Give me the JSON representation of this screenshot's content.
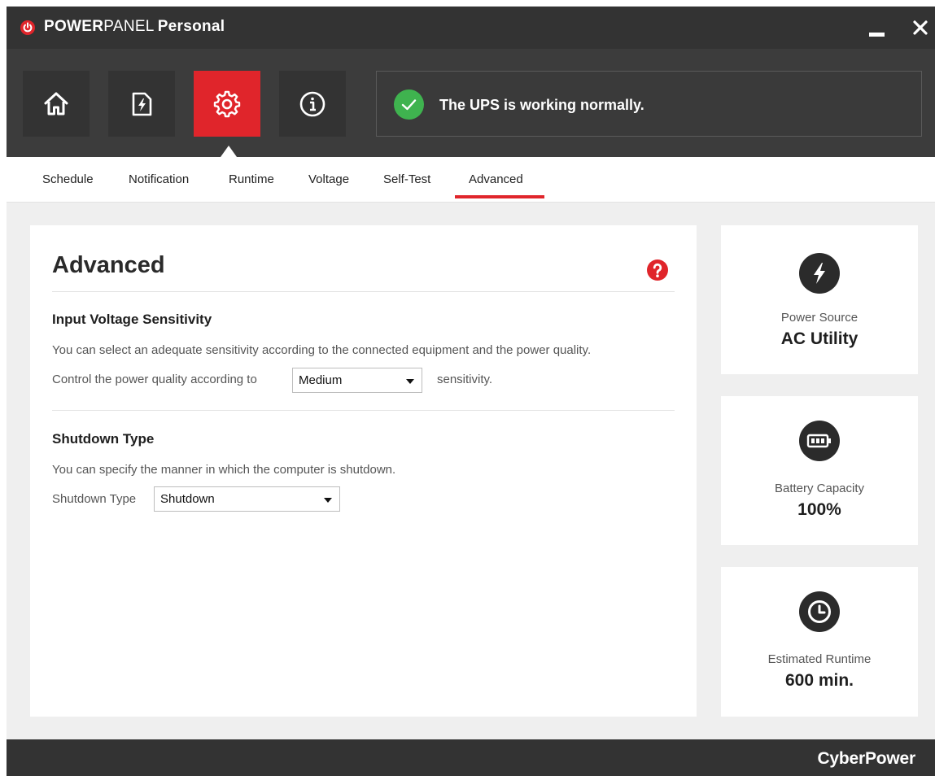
{
  "app": {
    "title_bold": "POWER",
    "title_light": "PANEL",
    "title_edition": "Personal"
  },
  "toolbar": {
    "buttons": [
      {
        "icon": "home-icon",
        "active": false
      },
      {
        "icon": "power-event-icon",
        "active": false
      },
      {
        "icon": "settings-gear-icon",
        "active": true
      },
      {
        "icon": "info-icon",
        "active": false
      }
    ],
    "status_text": "The UPS is working normally."
  },
  "tabs": [
    "Schedule",
    "Notification",
    "Runtime",
    "Voltage",
    "Self-Test",
    "Advanced"
  ],
  "active_tab": "Advanced",
  "main": {
    "title": "Advanced",
    "sensitivity": {
      "title": "Input Voltage Sensitivity",
      "description": "You can select an adequate sensitivity according to the connected equipment and the power quality.",
      "control_prefix": "Control the power quality according to",
      "selected": "Medium",
      "control_suffix": "sensitivity."
    },
    "shutdown": {
      "title": "Shutdown Type",
      "description": "You can specify the manner in which the computer is shutdown.",
      "label": "Shutdown Type",
      "selected": "Shutdown"
    }
  },
  "info": {
    "power_source": {
      "label": "Power Source",
      "value": "AC Utility"
    },
    "battery": {
      "label": "Battery Capacity",
      "value": "100%"
    },
    "runtime": {
      "label": "Estimated Runtime",
      "value": "600 min."
    }
  },
  "footer": {
    "brand": "CyberPower"
  },
  "colors": {
    "accent": "#e0252b",
    "titlebar": "#333333",
    "toolbar": "#3c3c3c",
    "status_ok": "#3fb34f"
  }
}
